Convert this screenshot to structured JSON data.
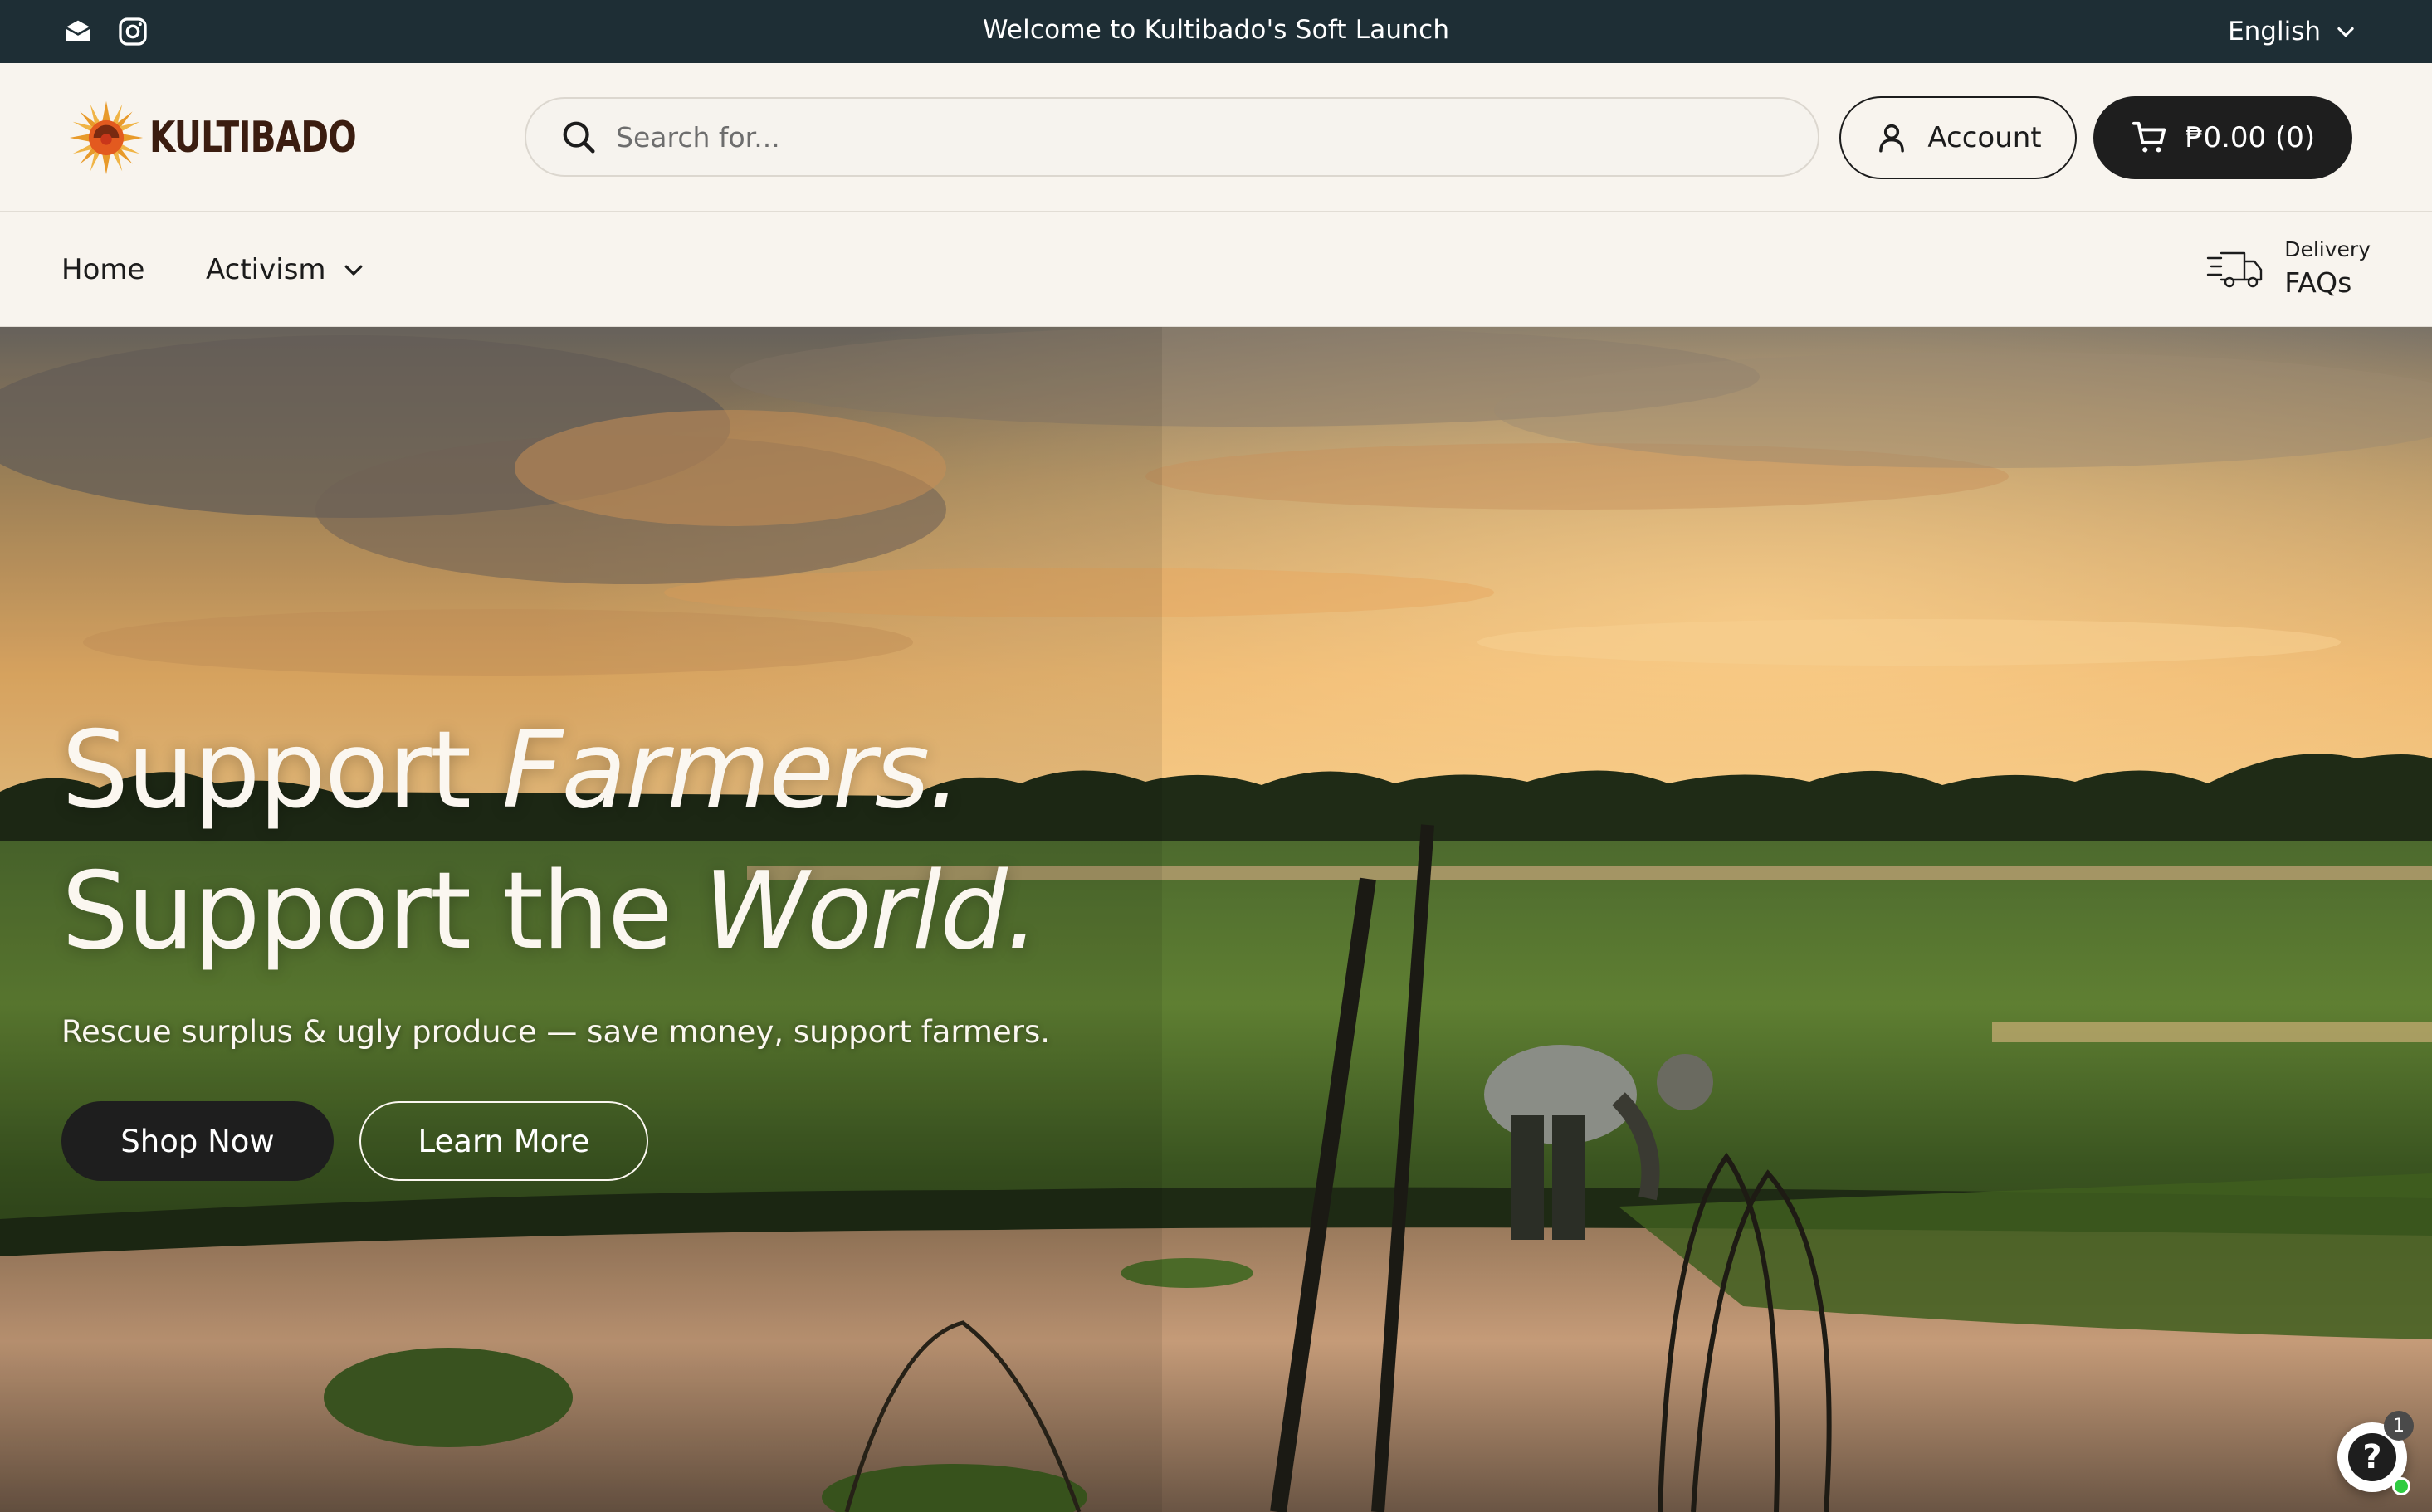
{
  "topbar": {
    "announcement": "Welcome to Kultibado's Soft Launch",
    "language": "English",
    "social_icons": [
      "email-icon",
      "instagram-icon"
    ]
  },
  "header": {
    "logo_text": "KULTIBADO",
    "search_placeholder": "Search for...",
    "account_label": "Account",
    "cart_label": "₱0.00 (0)"
  },
  "nav": {
    "items": [
      {
        "label": "Home"
      },
      {
        "label": "Activism",
        "has_dropdown": true
      }
    ],
    "delivery_small": "Delivery",
    "delivery_big": "FAQs"
  },
  "hero": {
    "line1_plain": "Support ",
    "line1_italic": "Farmers.",
    "line2_plain": "Support the ",
    "line2_italic": "World.",
    "subtitle": "Rescue surplus & ugly produce — save money, support farmers.",
    "primary_button": "Shop Now",
    "secondary_button": "Learn More"
  },
  "help_widget": {
    "icon": "?",
    "badge_count": "1"
  },
  "colors": {
    "topbar_bg": "#1e2e35",
    "page_bg": "#f8f4ee",
    "dark_button": "#1e1e1e",
    "logo_brown": "#3b1d10"
  }
}
